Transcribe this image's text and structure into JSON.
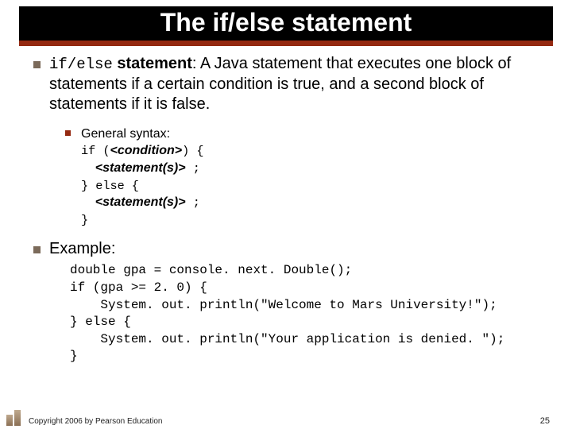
{
  "title": "The if/else statement",
  "main_point": {
    "term_code": "if/else",
    "term_bold": " statement",
    "definition": ": A Java statement that executes one block of statements if a certain condition is true, and a second block of statements if it is false."
  },
  "syntax": {
    "label": "General syntax:",
    "l1a": "if (",
    "l1b": "<condition>",
    "l1c": ") {",
    "l2a": "<statement(s)>",
    "l2b": " ;",
    "l3": "} else {",
    "l4a": "<statement(s)>",
    "l4b": " ;",
    "l5": "}"
  },
  "example": {
    "heading": "Example:",
    "code": "double gpa = console. next. Double();\nif (gpa >= 2. 0) {\n    System. out. println(\"Welcome to Mars University!\");\n} else {\n    System. out. println(\"Your application is denied. \");\n}"
  },
  "footer": "Copyright 2006 by Pearson Education",
  "page_number": "25"
}
